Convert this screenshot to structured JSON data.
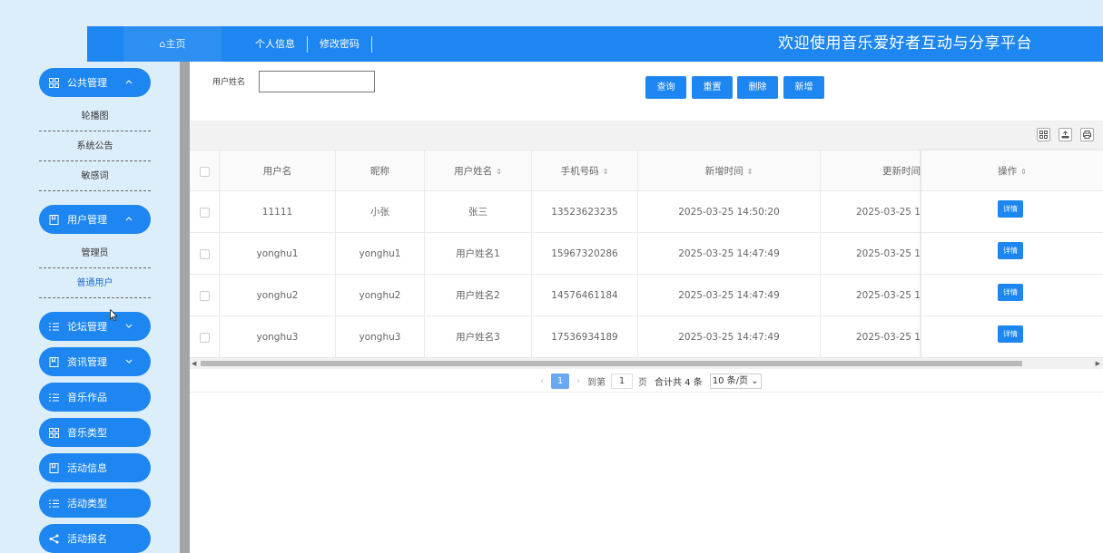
{
  "topbar": {
    "home": "⌂主页",
    "nav": [
      "个人信息",
      "修改密码"
    ],
    "title": "欢迎使用音乐爱好者互动与分享平台"
  },
  "sidebar": {
    "groups": [
      {
        "label": "公共管理",
        "icon": "grid-icon",
        "expanded": true,
        "children": [
          "轮播图",
          "系统公告",
          "敏感词"
        ]
      },
      {
        "label": "用户管理",
        "icon": "bookmark-icon",
        "expanded": true,
        "children": [
          "管理员",
          "普通用户"
        ],
        "active_child": "普通用户"
      },
      {
        "label": "论坛管理",
        "icon": "list-icon",
        "expanded": false
      },
      {
        "label": "资讯管理",
        "icon": "bookmark-icon",
        "expanded": false
      },
      {
        "label": "音乐作品",
        "icon": "list-icon"
      },
      {
        "label": "音乐类型",
        "icon": "grid-icon"
      },
      {
        "label": "活动信息",
        "icon": "bookmark-icon"
      },
      {
        "label": "活动类型",
        "icon": "list-icon"
      },
      {
        "label": "活动报名",
        "icon": "share-icon"
      }
    ]
  },
  "search": {
    "label": "用户姓名",
    "value": "",
    "buttons": [
      "查询",
      "重置",
      "删除",
      "新增"
    ]
  },
  "table": {
    "columns": [
      "用户名",
      "昵称",
      "用户姓名",
      "手机号码",
      "新增时间",
      "更新时间",
      "操作"
    ],
    "rows": [
      {
        "username": "11111",
        "nickname": "小张",
        "realname": "张三",
        "phone": "13523623235",
        "created": "2025-03-25 14:50:20",
        "updated": "2025-03-25 1",
        "action": "详情"
      },
      {
        "username": "yonghu1",
        "nickname": "yonghu1",
        "realname": "用户姓名1",
        "phone": "15967320286",
        "created": "2025-03-25 14:47:49",
        "updated": "2025-03-25 1",
        "action": "详情"
      },
      {
        "username": "yonghu2",
        "nickname": "yonghu2",
        "realname": "用户姓名2",
        "phone": "14576461184",
        "created": "2025-03-25 14:47:49",
        "updated": "2025-03-25 1",
        "action": "详情"
      },
      {
        "username": "yonghu3",
        "nickname": "yonghu3",
        "realname": "用户姓名3",
        "phone": "17536934189",
        "created": "2025-03-25 14:47:49",
        "updated": "2025-03-25 1",
        "action": "详情"
      }
    ]
  },
  "pager": {
    "current": "1",
    "goto_label": "到第",
    "goto_value": "1",
    "page_unit": "页",
    "total": "合计共 4 条",
    "page_size": "10 条/页"
  },
  "colors": {
    "primary": "#1e86f0",
    "background": "#ddeefb"
  }
}
